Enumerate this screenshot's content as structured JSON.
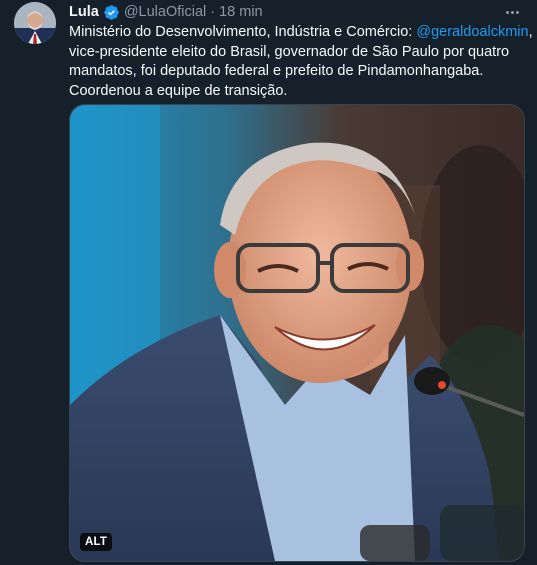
{
  "tweet": {
    "author": {
      "display_name": "Lula",
      "handle": "@LulaOficial",
      "verified": true,
      "avatar_icon": "profile-photo-avatar"
    },
    "time_separator": "·",
    "timestamp": "18 min",
    "more_icon": "more-horizontal-icon",
    "body": {
      "line1_text": "Ministério do Desenvolvimento, Indústria e Comércio: ",
      "line1_mention": "@geraldoalckmin",
      "line1_tail": ",",
      "line2": "vice-presidente eleito do Brasil, governador de São Paulo por quatro",
      "line3": "mandatos, foi deputado federal e prefeito de Pindamonhangaba.",
      "line4": "Coordenou a equipe de transição."
    },
    "media": {
      "type": "photo",
      "alt_badge": "ALT"
    }
  },
  "colors": {
    "background": "#15202b",
    "text": "#f7f9f9",
    "secondary": "#8b98a5",
    "mention": "#1d9bf0",
    "verified_badge": "#1d9bf0"
  }
}
